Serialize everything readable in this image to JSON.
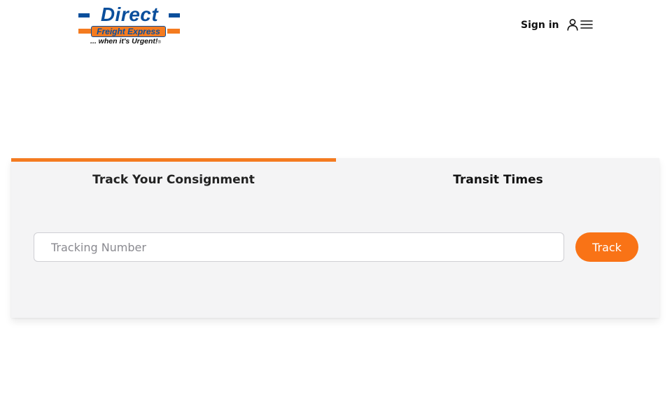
{
  "header": {
    "logo": {
      "word": "Direct",
      "band_text": "Freight Express",
      "tagline": "... when it's Urgent!",
      "reg_mark": "®"
    },
    "sign_in_label": "Sign in",
    "user_icon": "user-icon",
    "menu_icon": "hamburger-menu-icon"
  },
  "tracking": {
    "tabs": [
      {
        "label": "Track Your Consignment",
        "active": true
      },
      {
        "label": "Transit Times",
        "active": false
      }
    ],
    "input_placeholder": "Tracking Number",
    "input_value": "",
    "button_label": "Track"
  },
  "colors": {
    "brand_blue": "#0b4f9c",
    "brand_orange": "#f47b20",
    "button_orange": "#f97316",
    "card_background": "#f4f4f5"
  }
}
